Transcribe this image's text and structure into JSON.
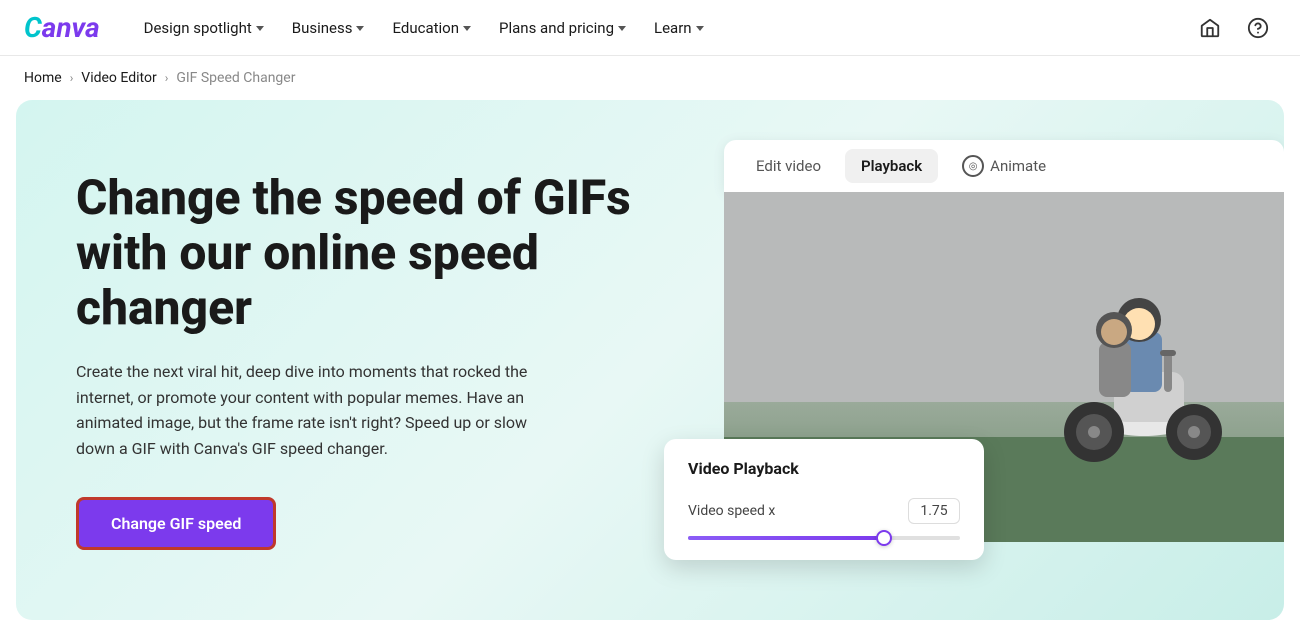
{
  "logo": {
    "c": "C",
    "anva": "anva"
  },
  "nav": {
    "links": [
      {
        "id": "design-spotlight",
        "label": "Design spotlight"
      },
      {
        "id": "business",
        "label": "Business"
      },
      {
        "id": "education",
        "label": "Education"
      },
      {
        "id": "plans-pricing",
        "label": "Plans and pricing"
      },
      {
        "id": "learn",
        "label": "Learn"
      }
    ],
    "icons": {
      "home": "⌂",
      "help": "?"
    }
  },
  "breadcrumb": {
    "home": "Home",
    "video_editor": "Video Editor",
    "current": "GIF Speed Changer",
    "sep": "›"
  },
  "hero": {
    "title": "Change the speed of GIFs with our online speed changer",
    "description": "Create the next viral hit, deep dive into moments that rocked the internet, or promote your content with popular memes. Have an animated image, but the frame rate isn't right? Speed up or slow down a GIF with Canva's GIF speed changer.",
    "cta_label": "Change GIF speed"
  },
  "editor_ui": {
    "tabs": [
      {
        "id": "edit-video",
        "label": "Edit video",
        "active": false
      },
      {
        "id": "playback",
        "label": "Playback",
        "active": true
      },
      {
        "id": "animate",
        "label": "Animate",
        "active": false
      }
    ],
    "playback_card": {
      "title": "Video Playback",
      "speed_label": "Video speed x",
      "speed_value": "1.75",
      "slider_percent": 72
    }
  }
}
